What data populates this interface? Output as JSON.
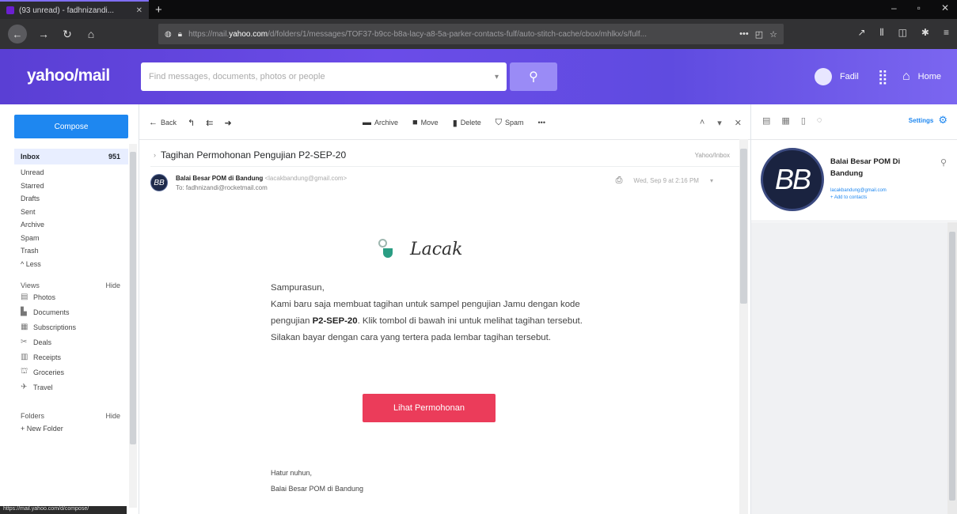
{
  "browser": {
    "tab_title": "(93 unread) - fadhnizandi...",
    "url_prefix": "https://mail.",
    "url_domain": "yahoo.com",
    "url_path": "/d/folders/1/messages/TOF37-b9cc-b8a-lacy-a8-5a-parker-contacts-fulf/auto-stitch-cache/cbox/mhlkx/s/fulf..."
  },
  "yahoo": {
    "logo": "yahoo/mail",
    "search_placeholder": "Find messages, documents, photos or people",
    "user_name": "Fadil",
    "home_label": "Home"
  },
  "sidebar": {
    "compose": "Compose",
    "folders": [
      {
        "label": "Inbox",
        "count": "951"
      },
      {
        "label": "Unread",
        "count": ""
      },
      {
        "label": "Starred",
        "count": ""
      },
      {
        "label": "Drafts",
        "count": ""
      },
      {
        "label": "Sent",
        "count": ""
      },
      {
        "label": "Archive",
        "count": ""
      },
      {
        "label": "Spam",
        "count": ""
      },
      {
        "label": "Trash",
        "count": ""
      },
      {
        "label": "^ Less",
        "count": ""
      }
    ],
    "views_header": "Views",
    "views_hide": "Hide",
    "views": [
      {
        "label": "Photos",
        "icon": "image-icon"
      },
      {
        "label": "Documents",
        "icon": "document-icon"
      },
      {
        "label": "Subscriptions",
        "icon": "subscriptions-icon"
      },
      {
        "label": "Deals",
        "icon": "scissors-icon"
      },
      {
        "label": "Receipts",
        "icon": "receipt-icon"
      },
      {
        "label": "Groceries",
        "icon": "groceries-icon"
      },
      {
        "label": "Travel",
        "icon": "plane-icon"
      }
    ],
    "folders_header": "Folders",
    "folders_hide": "Hide",
    "new_folder": "+ New Folder",
    "status_url": "https://mail.yahoo.com/d/compose/"
  },
  "toolbar": {
    "back": "Back",
    "archive": "Archive",
    "move": "Move",
    "delete": "Delete",
    "spam": "Spam",
    "more": "•••"
  },
  "message": {
    "subject": "Tagihan Permohonan Pengujian P2-SEP-20",
    "location": "Yahoo/Inbox",
    "sender_name": "Balai Besar POM di Bandung",
    "sender_email": "<lacakbandung@gmail.com>",
    "to_line": "To: fadhnizandi@rocketmail.com",
    "date": "Wed, Sep 9 at 2:16 PM",
    "avatar_initials": "BB"
  },
  "email": {
    "brand": "Lacak",
    "greeting": "Sampurasun,",
    "para_1": "Kami baru saja membuat tagihan untuk sampel pengujian Jamu dengan kode pengujian ",
    "code": "P2-SEP-20",
    "para_2": ". Klik tombol di bawah ini untuk melihat tagihan tersebut. Silakan bayar dengan cara yang tertera pada lembar tagihan tersebut.",
    "button": "Lihat Permohonan",
    "closing": "Hatur nuhun,",
    "signature": "Balai Besar POM di Bandung"
  },
  "contact": {
    "initials": "BB",
    "name": "Balai Besar POM Di Bandung",
    "email": "lacakbandung@gmail.com",
    "add": "+ Add to contacts",
    "settings": "Settings"
  },
  "colors": {
    "accent": "#6b4ce8",
    "compose": "#1e87f0",
    "cta": "#eb3c5a"
  }
}
